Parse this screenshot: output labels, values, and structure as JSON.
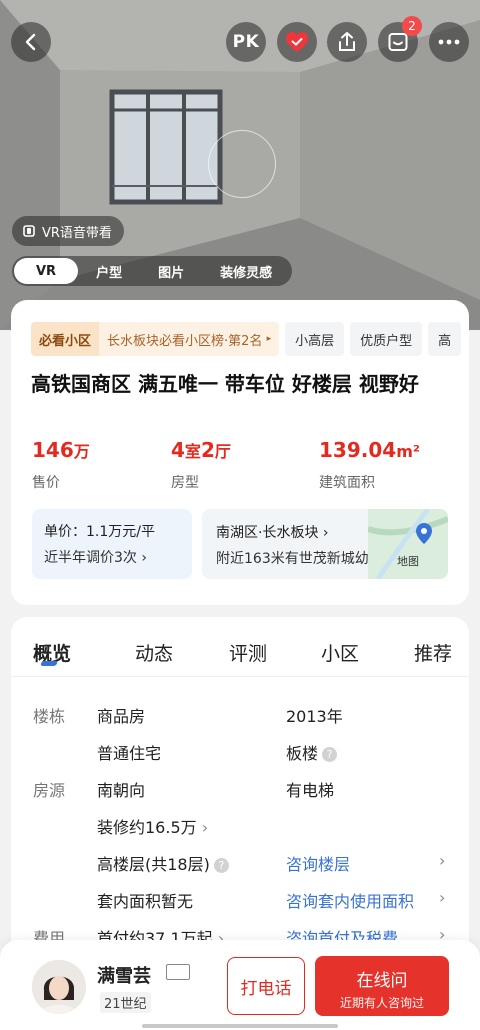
{
  "hero": {
    "pk_label": "PK",
    "notification_count": "2",
    "vr_voice_label": "VR语音带看",
    "media_tabs": [
      "VR",
      "户型",
      "图片",
      "装修灵感"
    ]
  },
  "listing": {
    "rank_tag": "必看小区",
    "rank_text": "长水板块必看小区榜·第2名",
    "tags": [
      "小高层",
      "优质户型",
      "高"
    ],
    "title": "高铁国商区 满五唯一 带车位 好楼层 视野好",
    "price_value": "146",
    "price_unit": "万",
    "price_label": "售价",
    "rooms_a": "4",
    "rooms_a_unit": "室",
    "rooms_b": "2",
    "rooms_b_unit": "厅",
    "rooms_label": "房型",
    "area_value": "139.04",
    "area_unit": "m²",
    "area_label": "建筑面积",
    "unit_price": "单价：1.1万元/平",
    "price_changes": "近半年调价3次",
    "location": "南湖区·长水板块",
    "nearby": "附近163米有世茂新城幼…",
    "map_label": "地图"
  },
  "details": {
    "tabs": [
      "概览",
      "动态",
      "评测",
      "小区",
      "推荐"
    ],
    "building_label": "楼栋",
    "building_type": "商品房",
    "built_year": "2013年",
    "residence_type": "普通住宅",
    "structure": "板楼",
    "source_label": "房源",
    "orientation": "南朝向",
    "elevator": "有电梯",
    "renovation": "装修约16.5万",
    "floor": "高楼层(共18层)",
    "ask_floor": "咨询楼层",
    "inner_area": "套内面积暂无",
    "ask_inner_area": "咨询套内使用面积",
    "cost_label": "费用",
    "down_payment": "首付约37.1万起",
    "ask_down_payment": "咨询首付及税费"
  },
  "agent": {
    "name": "满雪芸",
    "company": "21世纪",
    "call_label": "打电话",
    "chat_label": "在线问",
    "chat_sub": "近期有人咨询过"
  },
  "colors": {
    "accent_red": "#e5291f",
    "link_blue": "#3a73d8"
  }
}
